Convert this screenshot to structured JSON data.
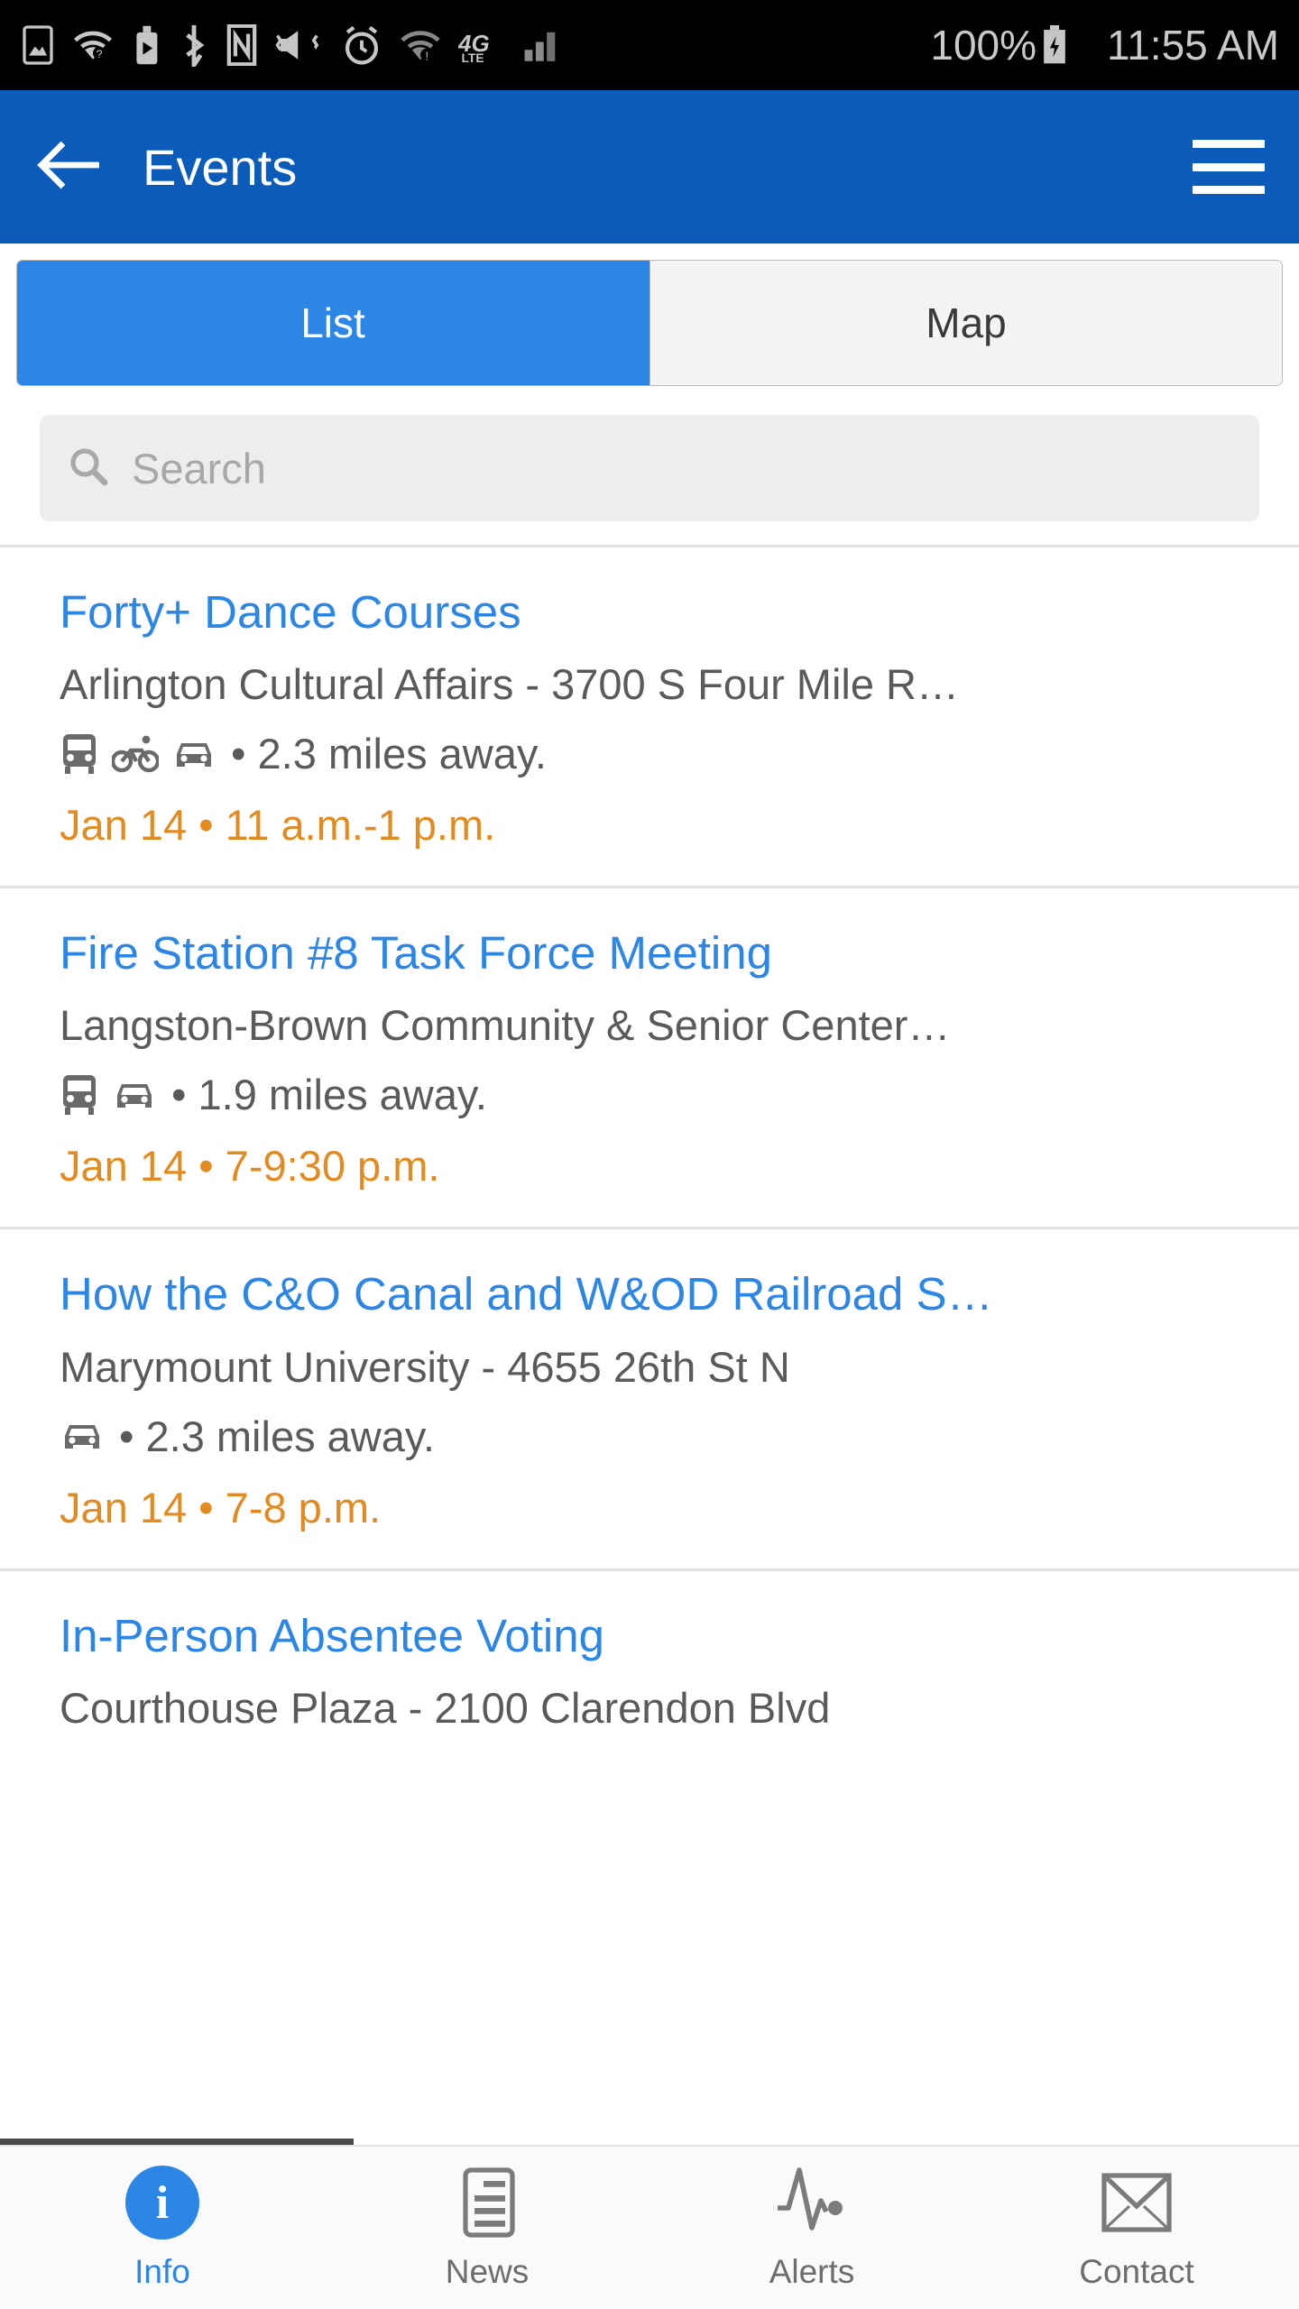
{
  "status_bar": {
    "icons": [
      "photo-icon",
      "wifi-question-icon",
      "cast-icon",
      "bluetooth-icon",
      "nfc-icon",
      "vibrate-off-icon",
      "alarm-icon",
      "wifi-warning-icon",
      "4g-lte-icon",
      "signal-bars-icon"
    ],
    "battery_text": "100%",
    "battery_icon": "battery-charging-icon",
    "time": "11:55 AM"
  },
  "app_bar": {
    "back_icon": "arrow-left-icon",
    "title": "Events",
    "menu_icon": "hamburger-menu-icon"
  },
  "tabs": {
    "items": [
      {
        "label": "List",
        "active": true
      },
      {
        "label": "Map",
        "active": false
      }
    ]
  },
  "search": {
    "icon": "search-icon",
    "placeholder": "Search",
    "value": ""
  },
  "events": [
    {
      "title": "Forty+ Dance Courses",
      "address": "Arlington Cultural Affairs - 3700 S Four Mile R…",
      "modes": [
        "bus-icon",
        "bike-icon",
        "car-icon"
      ],
      "distance": "• 2.3 miles away.",
      "date": "Jan 14 • 11 a.m.-1 p.m."
    },
    {
      "title": "Fire Station #8 Task Force Meeting",
      "address": "Langston-Brown Community & Senior Center…",
      "modes": [
        "bus-icon",
        "car-icon"
      ],
      "distance": "• 1.9 miles away.",
      "date": "Jan 14 • 7-9:30 p.m."
    },
    {
      "title": "How the C&O Canal and W&OD Railroad S…",
      "address": "Marymount University - 4655 26th St N",
      "modes": [
        "car-icon"
      ],
      "distance": "• 2.3 miles away.",
      "date": "Jan 14 • 7-8 p.m."
    },
    {
      "title": "In-Person Absentee Voting",
      "address": "Courthouse Plaza - 2100 Clarendon Blvd",
      "modes": [],
      "distance": "",
      "date": ""
    }
  ],
  "bottom_nav": {
    "items": [
      {
        "label": "Info",
        "icon": "info-circle-icon",
        "active": true
      },
      {
        "label": "News",
        "icon": "news-document-icon",
        "active": false
      },
      {
        "label": "Alerts",
        "icon": "pulse-alert-icon",
        "active": false
      },
      {
        "label": "Contact",
        "icon": "envelope-icon",
        "active": false
      }
    ]
  },
  "colors": {
    "app_bar_blue": "#0b5bba",
    "accent_blue": "#2b86e6",
    "link_blue": "#2b86e6",
    "date_orange": "#e28b20",
    "body_gray": "#5a5a5a",
    "search_bg": "#ededed"
  }
}
